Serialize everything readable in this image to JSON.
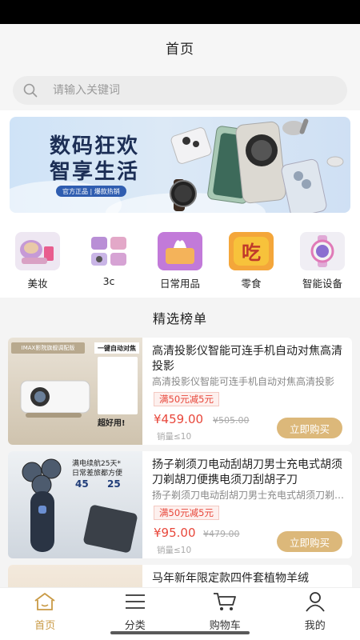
{
  "header": {
    "title": "首页"
  },
  "search": {
    "placeholder": "请输入关键词",
    "icon": "search-icon"
  },
  "banner": {
    "line1": "数码狂欢",
    "line2": "智享生活",
    "tag": "官方正品 | 爆款热销"
  },
  "categories": [
    {
      "label": "美妆",
      "icon": "cosmetics-icon"
    },
    {
      "label": "3c",
      "icon": "electronics-icon"
    },
    {
      "label": "日常用品",
      "icon": "tissue-box-icon"
    },
    {
      "label": "零食",
      "icon": "snack-icon"
    },
    {
      "label": "智能设备",
      "icon": "smartwatch-icon"
    }
  ],
  "section": {
    "title": "精选榜单"
  },
  "products": [
    {
      "name": "高清投影仪智能可连手机自动对焦高清投影",
      "subtitle": "高清投影仪智能可连手机自动对焦高清投影",
      "coupon": "满50元减5元",
      "price": "¥459.00",
      "old_price": "¥505.00",
      "sold": "销量≤10",
      "buy_label": "立即购买",
      "image_text_1": "IMAX影院旗舰调配版",
      "image_text_2": "一键自动对焦",
      "image_text_3": "超好用!"
    },
    {
      "name": "扬子剃须刀电动刮胡刀男士充电式胡须刀剃胡刀便携电须刀刮胡子刀",
      "subtitle": "扬子剃须刀电动刮胡刀男士充电式胡须刀剃胡刀便携电须刀刮胡子刀",
      "coupon": "满50元减5元",
      "price": "¥95.00",
      "old_price": "¥479.00",
      "sold": "销量≤10",
      "buy_label": "立即购买",
      "image_text_1": "满电续航25天*",
      "image_text_2": "日常差旅都方便",
      "image_text_3": "45",
      "image_text_4": "25"
    },
    {
      "name": "马年新年限定款四件套植物羊绒",
      "subtitle": "",
      "coupon": "",
      "price": "",
      "old_price": "",
      "sold": "",
      "buy_label": ""
    }
  ],
  "tabs": [
    {
      "label": "首页",
      "icon": "home-icon",
      "active": true
    },
    {
      "label": "分类",
      "icon": "category-icon",
      "active": false
    },
    {
      "label": "购物车",
      "icon": "cart-icon",
      "active": false
    },
    {
      "label": "我的",
      "icon": "user-icon",
      "active": false
    }
  ],
  "colors": {
    "accent": "#c99a45",
    "price": "#e8473b",
    "buy_button": "#dcb87a"
  }
}
